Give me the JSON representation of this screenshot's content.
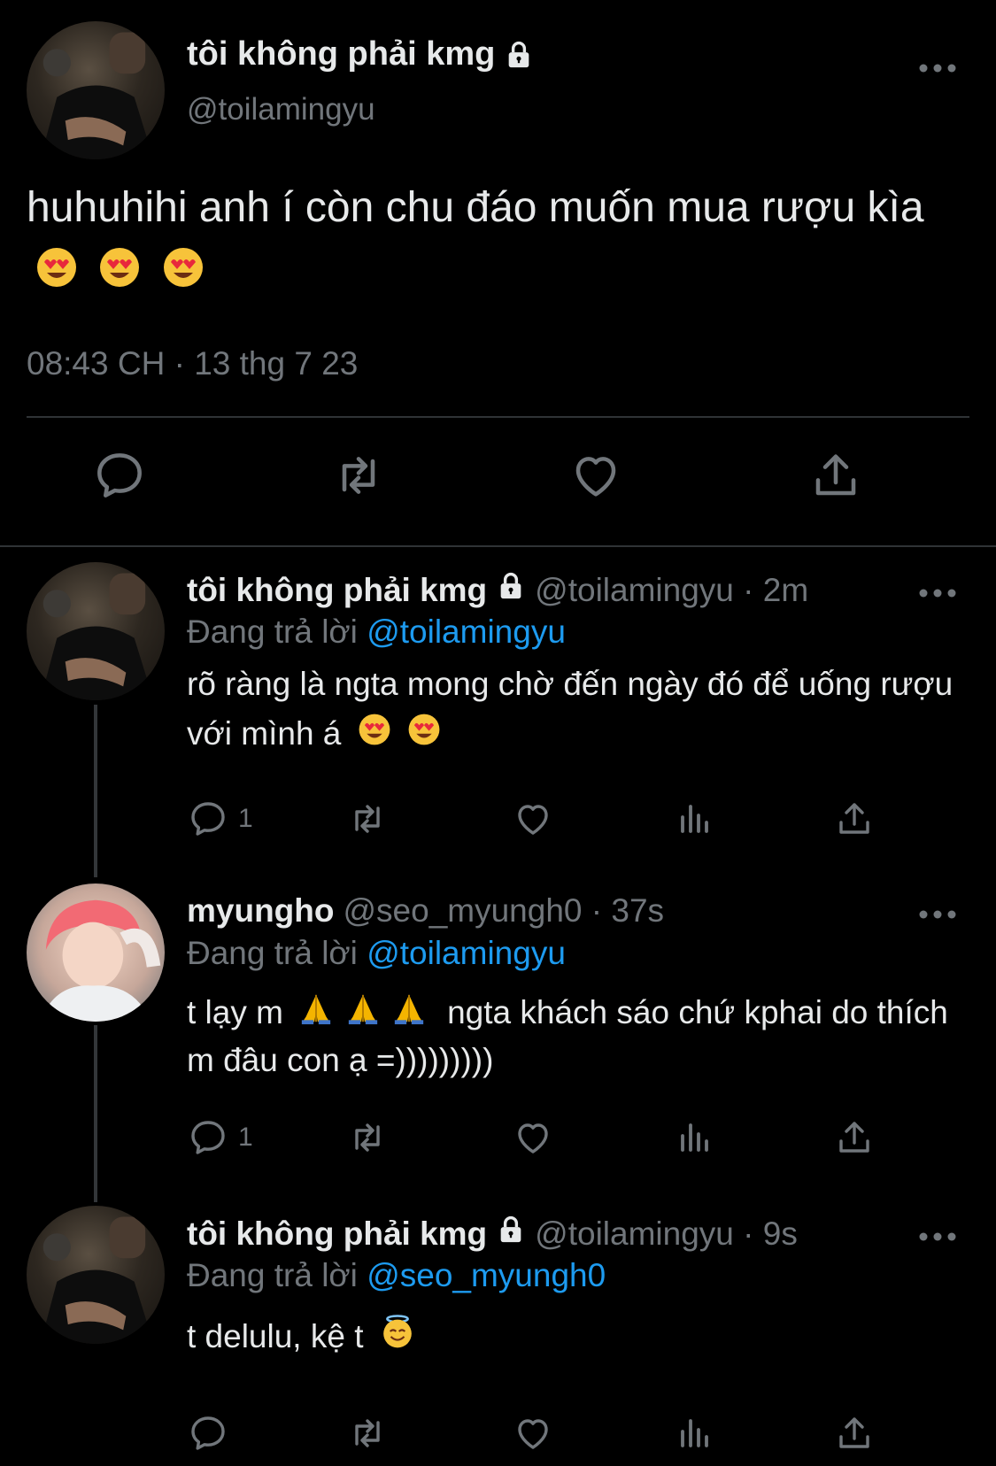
{
  "main_tweet": {
    "display_name": "tôi không phải kmg",
    "handle": "@toilamingyu",
    "text": "huhuhihi anh í còn chu đáo muốn mua rượu kìa",
    "emojis": [
      "heart-eyes",
      "heart-eyes",
      "heart-eyes"
    ],
    "timestamp": "08:43 CH · 13 thg 7 23",
    "icons": {
      "actions": [
        "reply-icon",
        "retweet-icon",
        "like-icon",
        "share-icon"
      ],
      "more": "more-icon",
      "lock": "lock-icon"
    }
  },
  "replies": [
    {
      "display_name": "tôi không phải kmg",
      "handle_time": "@toilamingyu · 2m",
      "replying_prefix": "Đang trả lời",
      "replying_to": "@toilamingyu",
      "text": "rõ ràng là ngta mong chờ đến ngày đó để uống rượu với mình á",
      "reply_count": "1",
      "locked": true
    },
    {
      "display_name": "myungho",
      "handle_time": "@seo_myungh0 · 37s",
      "replying_prefix": "Đang trả lời",
      "replying_to": "@toilamingyu",
      "text_before": "t lạy m",
      "text_after": "ngta khách sáo chứ kphai do thích m đâu con ạ =)))))))))",
      "reply_count": "1",
      "locked": false
    },
    {
      "display_name": "tôi không phải kmg",
      "handle_time": "@toilamingyu · 9s",
      "replying_prefix": "Đang trả lời",
      "replying_to": "@seo_myungh0",
      "text": "t delulu, kệ t",
      "reply_count": "",
      "locked": true
    }
  ],
  "colors": {
    "background": "#000000",
    "text": "#e7e9ea",
    "muted": "#71767b",
    "mention": "#1d9bf0",
    "divider": "#2f3336"
  }
}
